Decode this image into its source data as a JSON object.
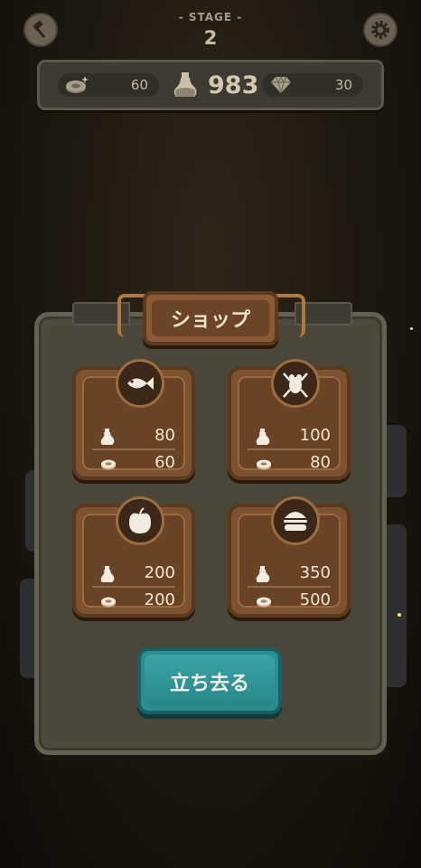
{
  "header": {
    "stage_label": "- STAGE -",
    "stage_number": "2",
    "left_icon": "hammer-icon",
    "right_icon": "gear-icon"
  },
  "resources": {
    "coins": "60",
    "potions": "983",
    "gems": "30"
  },
  "shop": {
    "title": "ショップ",
    "items": [
      {
        "icon": "fish-icon",
        "potion_cost": "80",
        "coin_cost": "60"
      },
      {
        "icon": "frog-icon",
        "potion_cost": "100",
        "coin_cost": "80"
      },
      {
        "icon": "apple-icon",
        "potion_cost": "200",
        "coin_cost": "200"
      },
      {
        "icon": "burger-icon",
        "potion_cost": "350",
        "coin_cost": "500"
      }
    ],
    "leave_label": "立ち去る"
  },
  "colors": {
    "background": "#1c170f",
    "panel": "#4d4a3c",
    "card": "#7e5230",
    "button": "#2b8d8f",
    "text": "#f2e7d3"
  }
}
